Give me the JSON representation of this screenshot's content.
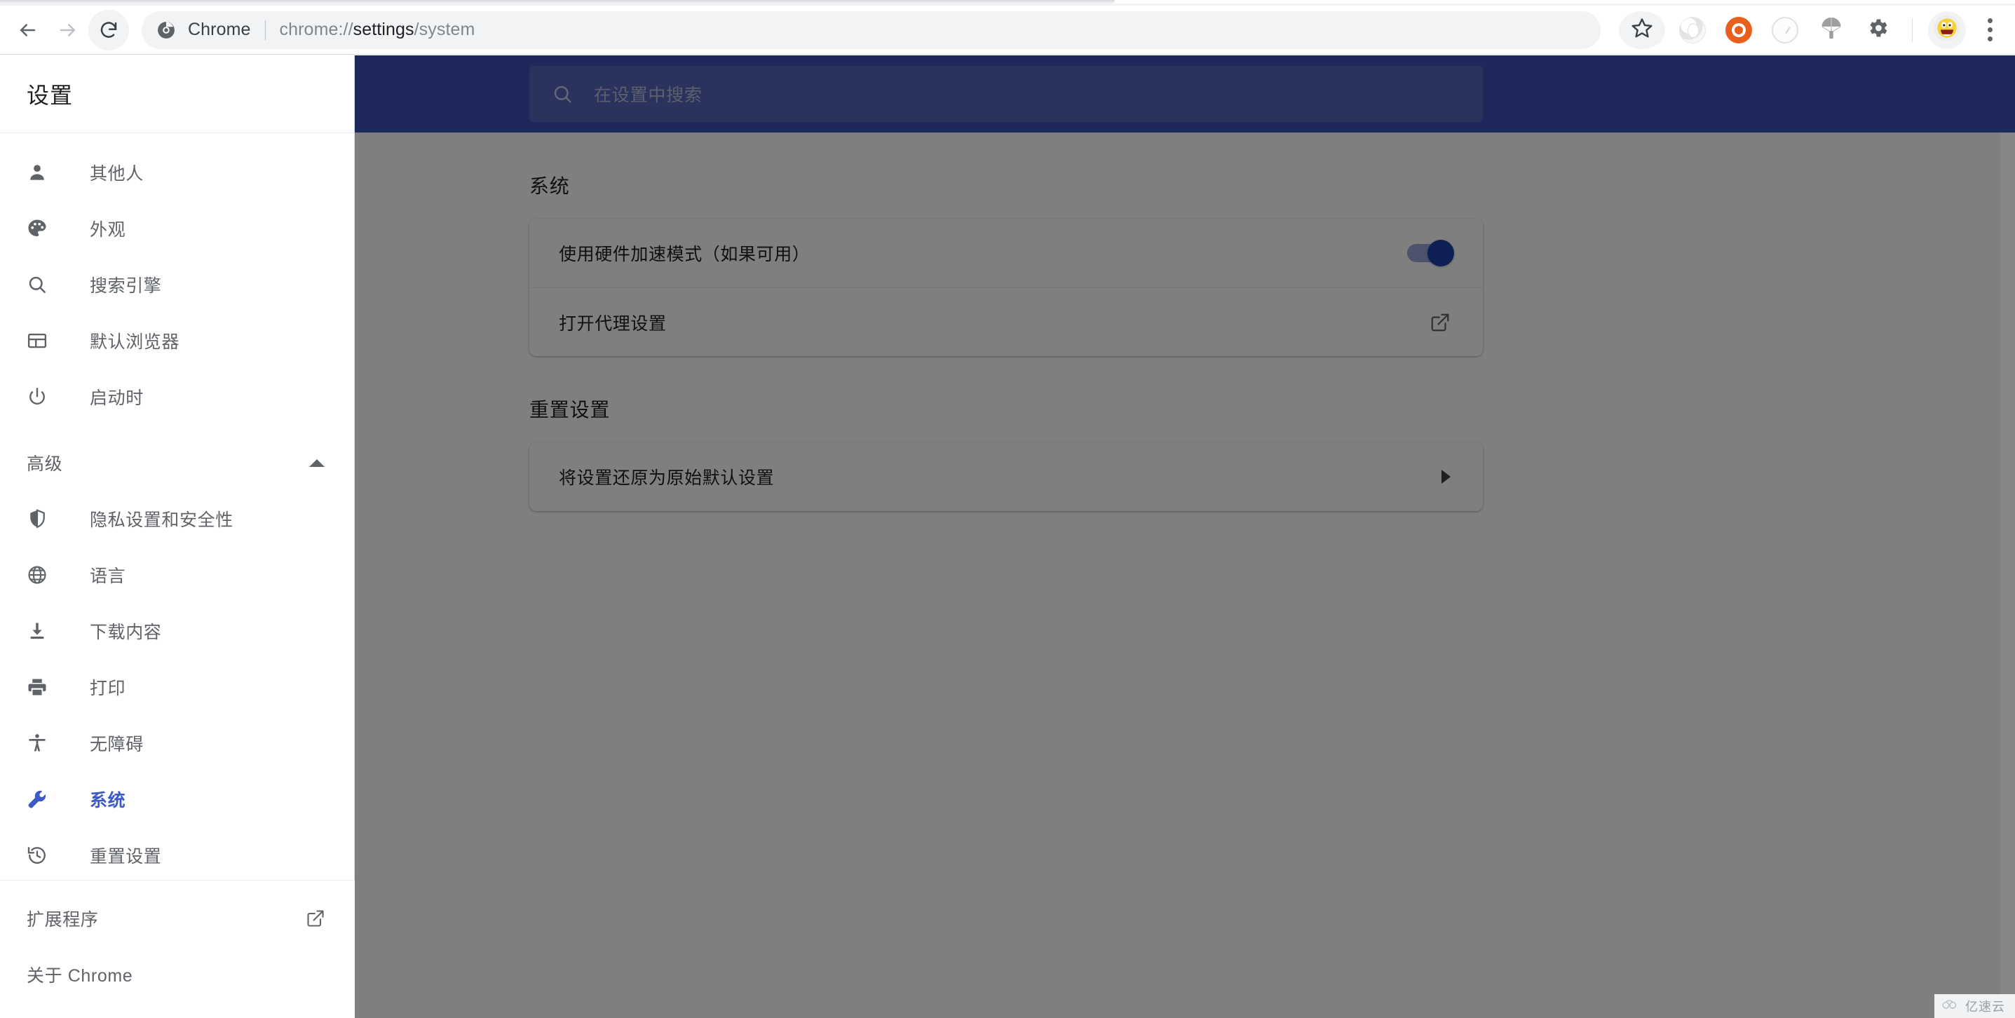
{
  "browser": {
    "omnibox": {
      "app_name": "Chrome",
      "url_prefix": "chrome://",
      "url_strong": "settings",
      "url_suffix": "/system",
      "full_url": "chrome://settings/system",
      "chrome_logo_icon": "chrome-logo-icon"
    },
    "nav": {
      "back_icon": "back-arrow-icon",
      "forward_icon": "forward-arrow-icon",
      "reload_icon": "reload-icon"
    },
    "actions": {
      "bookmark_icon": "star-outline-icon",
      "extension_ring_icon": "extension-ring-icon",
      "extension_orange_icon": "extension-orange-icon",
      "extension_gauge_icon": "extension-speedometer-icon",
      "extension_parachute_icon": "extension-parachute-icon",
      "extension_gear_icon": "extension-gear-icon",
      "avatar_icon": "smiley-avatar-icon",
      "menu_icon": "three-dot-menu-icon"
    }
  },
  "sidebar": {
    "title": "设置",
    "items": [
      {
        "label": "其他人",
        "icon": "person-icon",
        "selected": false
      },
      {
        "label": "外观",
        "icon": "palette-icon",
        "selected": false
      },
      {
        "label": "搜索引擎",
        "icon": "search-icon",
        "selected": false
      },
      {
        "label": "默认浏览器",
        "icon": "browser-window-icon",
        "selected": false
      },
      {
        "label": "启动时",
        "icon": "power-icon",
        "selected": false
      }
    ],
    "advanced_section": {
      "label": "高级",
      "expand_icon": "caret-up-icon",
      "expanded": true,
      "items": [
        {
          "label": "隐私设置和安全性",
          "icon": "shield-icon",
          "selected": false
        },
        {
          "label": "语言",
          "icon": "globe-icon",
          "selected": false
        },
        {
          "label": "下载内容",
          "icon": "download-icon",
          "selected": false
        },
        {
          "label": "打印",
          "icon": "printer-icon",
          "selected": false
        },
        {
          "label": "无障碍",
          "icon": "accessibility-icon",
          "selected": false
        },
        {
          "label": "系统",
          "icon": "wrench-icon",
          "selected": true
        },
        {
          "label": "重置设置",
          "icon": "history-restore-icon",
          "selected": false
        }
      ]
    },
    "footer": [
      {
        "label": "扩展程序",
        "external_icon": "external-link-icon"
      },
      {
        "label": "关于 Chrome",
        "external_icon": ""
      }
    ],
    "selected_item_color": "#3b5ac4"
  },
  "search": {
    "placeholder": "在设置中搜索",
    "value": "",
    "icon": "search-icon",
    "header_color": "#3f51b5"
  },
  "main": {
    "sections": [
      {
        "title": "系统",
        "rows": [
          {
            "label": "使用硬件加速模式（如果可用）",
            "control": "toggle",
            "toggle_on": true
          },
          {
            "label": "打开代理设置",
            "control": "external-link",
            "icon": "external-link-icon"
          }
        ]
      },
      {
        "title": "重置设置",
        "rows": [
          {
            "label": "将设置还原为原始默认设置",
            "control": "chevron",
            "icon": "chevron-right-icon"
          }
        ]
      }
    ]
  },
  "watermark": {
    "text": "亿速云",
    "icon": "cloud-logo-icon"
  }
}
